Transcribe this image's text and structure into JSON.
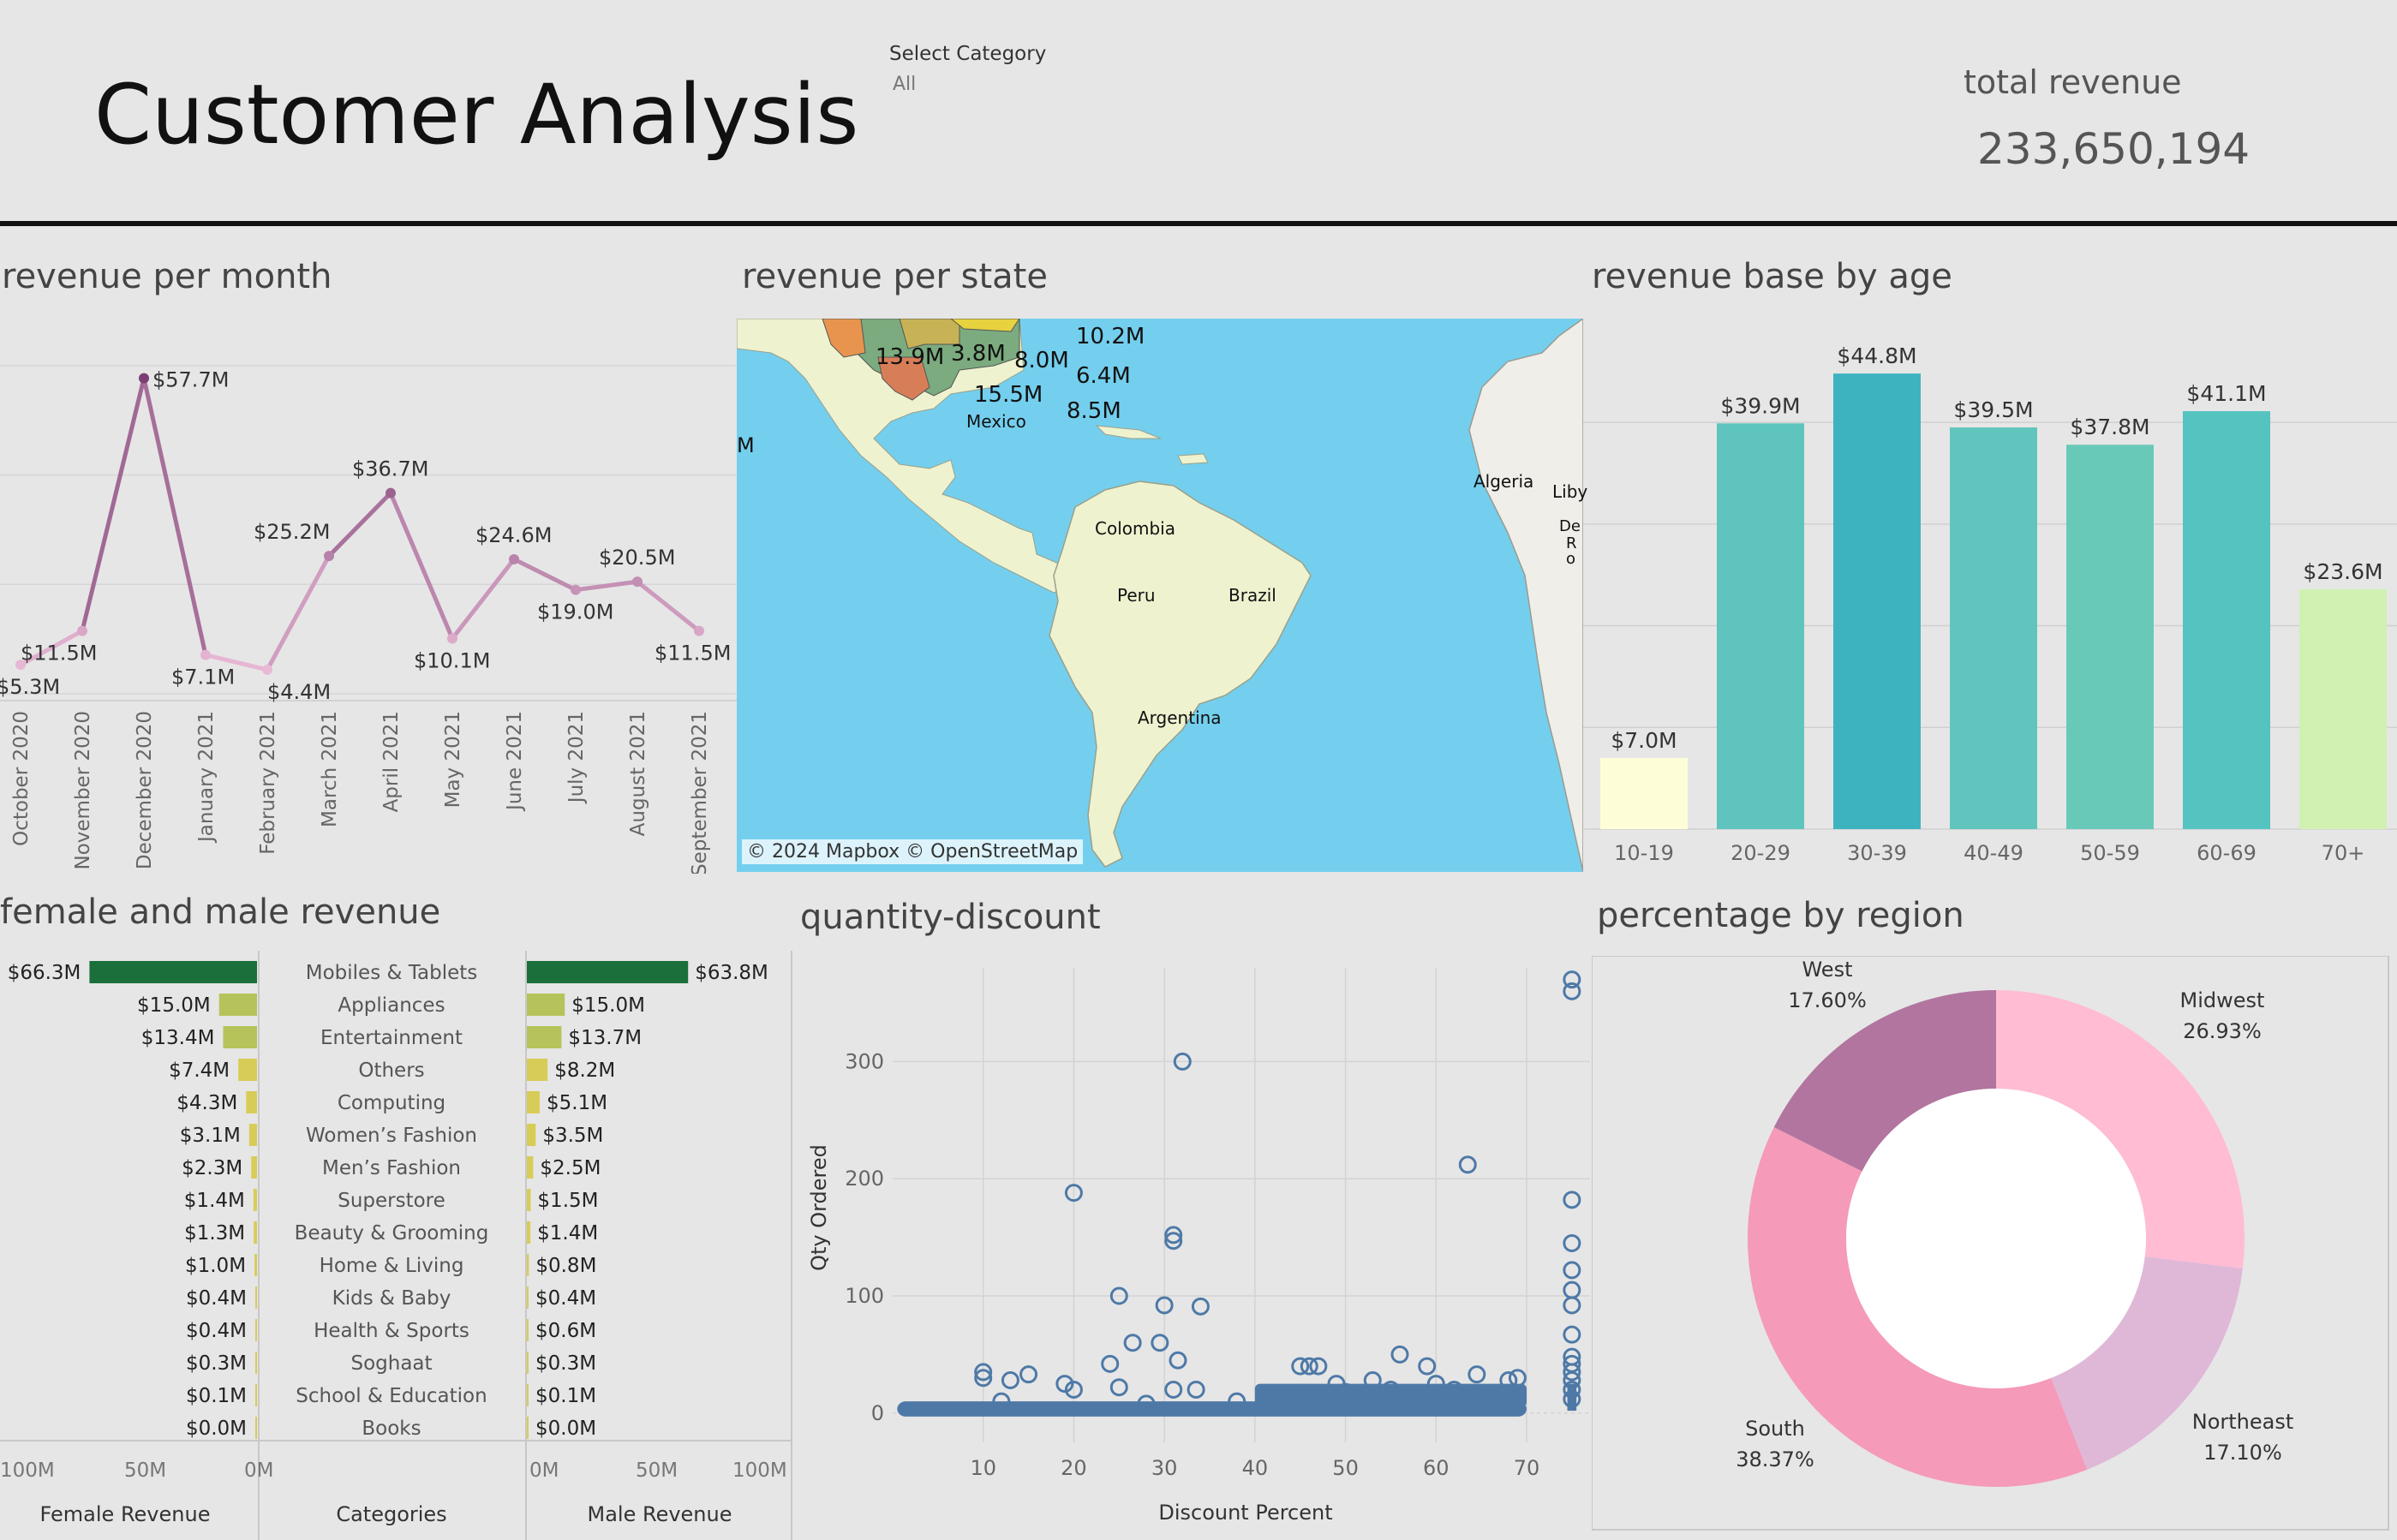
{
  "header": {
    "title": "Customer Analysis",
    "filter_label": "Select Category",
    "filter_value": "All",
    "kpi_label": "total revenue",
    "kpi_value": "233,650,194"
  },
  "panels": {
    "month": "revenue per month",
    "state": "revenue per state",
    "age": "revenue base by age",
    "gender": "female and male revenue",
    "qty": "quantity-discount",
    "region": "percentage by region"
  },
  "map": {
    "attribution": "© 2024 Mapbox © OpenStreetMap",
    "labels": [
      "13.9M",
      "3.8M",
      "8.0M",
      "10.2M",
      "6.4M",
      "15.5M",
      "8.5M",
      "Mexico",
      "Colombia",
      "Peru",
      "Brazil",
      "Argentina",
      "Algeria",
      "Liby",
      "De",
      "R",
      "o",
      "M"
    ],
    "colors": {
      "ocean": "#74cfee",
      "land": "#eef2cf",
      "land_africa": "#efeee8"
    }
  },
  "chart_data": [
    {
      "type": "line",
      "title": "revenue per month",
      "categories": [
        "October 2020",
        "November 2020",
        "December 2020",
        "January 2021",
        "February 2021",
        "March 2021",
        "April 2021",
        "May 2021",
        "June 2021",
        "July 2021",
        "August 2021",
        "September 2021"
      ],
      "values": [
        5.3,
        11.5,
        57.7,
        7.1,
        4.4,
        25.2,
        36.7,
        10.1,
        24.6,
        19.0,
        20.5,
        11.5
      ],
      "labels": [
        "$5.3M",
        "$11.5M",
        "$57.7M",
        "$7.1M",
        "$4.4M",
        "$25.2M",
        "$36.7M",
        "$10.1M",
        "$24.6M",
        "$19.0M",
        "$20.5M",
        "$11.5M"
      ],
      "ylim": [
        0,
        65
      ],
      "color_range": [
        "#f4c6e0",
        "#7b3f73"
      ]
    },
    {
      "type": "bar",
      "title": "revenue base by age",
      "categories": [
        "10-19",
        "20-29",
        "30-39",
        "40-49",
        "50-59",
        "60-69",
        "70+"
      ],
      "values": [
        7.0,
        39.9,
        44.8,
        39.5,
        37.8,
        41.1,
        23.6
      ],
      "labels": [
        "$7.0M",
        "$39.9M",
        "$44.8M",
        "$39.5M",
        "$37.8M",
        "$41.1M",
        "$23.6M"
      ],
      "colors": [
        "#fdfdd8",
        "#5ec4bd",
        "#3db3c0",
        "#60c5bd",
        "#69c9b8",
        "#55c3bf",
        "#d0f1b2"
      ],
      "ylim": [
        0,
        47
      ]
    },
    {
      "type": "bar",
      "title": "female and male revenue",
      "categories": [
        "Mobiles & Tablets",
        "Appliances",
        "Entertainment",
        "Others",
        "Computing",
        "Women’s Fashion",
        "Men’s Fashion",
        "Superstore",
        "Beauty & Grooming",
        "Home & Living",
        "Kids & Baby",
        "Health & Sports",
        "Soghaat",
        "School & Education",
        "Books"
      ],
      "series": [
        {
          "name": "Female Revenue",
          "values": [
            66.3,
            15.0,
            13.4,
            7.4,
            4.3,
            3.1,
            2.3,
            1.4,
            1.3,
            1.0,
            0.4,
            0.4,
            0.3,
            0.1,
            0.0
          ],
          "labels": [
            "$66.3M",
            "$15.0M",
            "$13.4M",
            "$7.4M",
            "$4.3M",
            "$3.1M",
            "$2.3M",
            "$1.4M",
            "$1.3M",
            "$1.0M",
            "$0.4M",
            "$0.4M",
            "$0.3M",
            "$0.1M",
            "$0.0M"
          ]
        },
        {
          "name": "Male Revenue",
          "values": [
            63.8,
            15.0,
            13.7,
            8.2,
            5.1,
            3.5,
            2.5,
            1.5,
            1.4,
            0.8,
            0.4,
            0.6,
            0.3,
            0.1,
            0.0
          ],
          "labels": [
            "$63.8M",
            "$15.0M",
            "$13.7M",
            "$8.2M",
            "$5.1M",
            "$3.5M",
            "$2.5M",
            "$1.5M",
            "$1.4M",
            "$0.8M",
            "$0.4M",
            "$0.6M",
            "$0.3M",
            "$0.1M",
            "$0.0M"
          ]
        }
      ],
      "xlim": [
        0,
        100
      ],
      "ticks": [
        "100M",
        "50M",
        "0M"
      ],
      "ticks_male": [
        "0M",
        "50M",
        "100M"
      ],
      "category_header": "Categories"
    },
    {
      "type": "scatter",
      "title": "quantity-discount",
      "xlabel": "Discount Percent",
      "ylabel": "Qty Ordered",
      "xlim": [
        0,
        77
      ],
      "ylim": [
        -25,
        380
      ],
      "xticks": [
        10,
        20,
        30,
        40,
        50,
        60,
        70
      ],
      "yticks": [
        0,
        100,
        200,
        300
      ],
      "color": "#4e79a7",
      "points": [
        [
          75,
          370
        ],
        [
          75,
          360
        ],
        [
          32,
          300
        ],
        [
          20,
          188
        ],
        [
          63.5,
          212
        ],
        [
          75,
          182
        ],
        [
          75,
          145
        ],
        [
          31,
          152
        ],
        [
          31,
          147
        ],
        [
          75,
          122
        ],
        [
          75,
          105
        ],
        [
          75,
          92
        ],
        [
          25,
          100
        ],
        [
          30,
          92
        ],
        [
          34,
          91
        ],
        [
          75,
          67
        ],
        [
          75,
          48
        ],
        [
          75,
          42
        ],
        [
          75,
          35
        ],
        [
          75,
          28
        ],
        [
          75,
          20
        ],
        [
          75,
          12
        ],
        [
          26.5,
          60
        ],
        [
          31.5,
          45
        ],
        [
          29.5,
          60
        ],
        [
          24,
          42
        ],
        [
          56,
          50
        ],
        [
          59,
          40
        ],
        [
          45,
          40
        ],
        [
          47,
          40
        ],
        [
          46,
          40
        ],
        [
          33.5,
          20
        ],
        [
          10,
          35
        ],
        [
          10,
          30
        ],
        [
          13,
          28
        ],
        [
          15,
          33
        ],
        [
          19,
          25
        ],
        [
          20,
          20
        ],
        [
          25,
          22
        ],
        [
          31,
          20
        ],
        [
          64.5,
          33
        ],
        [
          49,
          25
        ],
        [
          53,
          28
        ],
        [
          60,
          25
        ],
        [
          68,
          28
        ],
        [
          69,
          30
        ],
        [
          12,
          10
        ],
        [
          28,
          8
        ],
        [
          38,
          10
        ],
        [
          44,
          12
        ],
        [
          50,
          18
        ],
        [
          55,
          20
        ],
        [
          62,
          20
        ],
        [
          66,
          15
        ]
      ]
    },
    {
      "type": "pie",
      "title": "percentage by region",
      "categories": [
        "Midwest",
        "Northeast",
        "South",
        "West"
      ],
      "values": [
        26.93,
        17.1,
        38.37,
        17.6
      ],
      "labels": [
        "26.93%",
        "17.10%",
        "38.37%",
        "17.60%"
      ],
      "colors": [
        "#ffbcd2",
        "#dfb8d8",
        "#f59ab8",
        "#b1759f"
      ]
    }
  ]
}
